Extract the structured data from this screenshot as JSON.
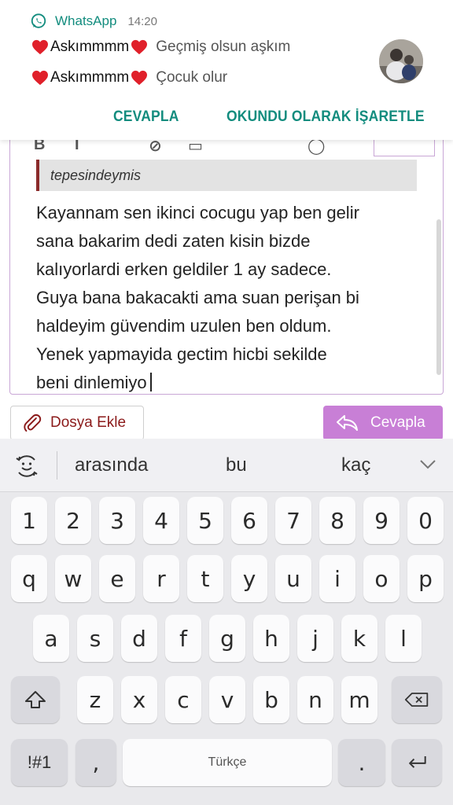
{
  "notification": {
    "app_name": "WhatsApp",
    "time": "14:20",
    "messages": [
      {
        "sender": "Askımmmm",
        "text": "Geçmiş olsun aşkım"
      },
      {
        "sender": "Askımmmm",
        "text": "Çocuk olur"
      }
    ],
    "actions": {
      "reply": "CEVAPLA",
      "mark_read": "OKUNDU OLARAK İŞARETLE"
    },
    "colors": {
      "accent": "#128c7e",
      "heart": "#e0202a"
    }
  },
  "editor": {
    "quote": "tepesindeymis",
    "body": "Kayannam sen ikinci cocugu yap ben gelir\nsana bakarim dedi zaten kisin bizde\nkalıyorlardi erken geldiler 1 ay sadece.\nGuya bana bakacakti ama suan perişan bi\nhaldeyim güvendim uzulen ben oldum.\nYenek yapmayida gectim hicbi sekilde\nbeni dinlemiyo"
  },
  "buttons": {
    "attach": "Dosya Ekle",
    "reply": "Cevapla",
    "reply_color": "#c87fd6"
  },
  "keyboard": {
    "suggestions": [
      "arasında",
      "bu",
      "kaç"
    ],
    "row_numbers": [
      "1",
      "2",
      "3",
      "4",
      "5",
      "6",
      "7",
      "8",
      "9",
      "0"
    ],
    "row_top": [
      "q",
      "w",
      "e",
      "r",
      "t",
      "y",
      "u",
      "i",
      "o",
      "p"
    ],
    "row_middle": [
      "a",
      "s",
      "d",
      "f",
      "g",
      "h",
      "j",
      "k",
      "l"
    ],
    "row_bottom": [
      "z",
      "x",
      "c",
      "v",
      "b",
      "n",
      "m"
    ],
    "symbols_label": "!#1",
    "comma": ",",
    "space_label": "Türkçe",
    "period": "."
  }
}
